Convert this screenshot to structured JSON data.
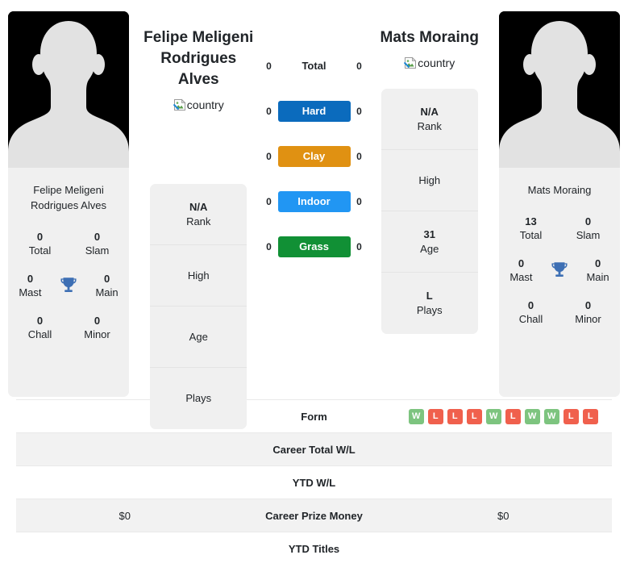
{
  "left_player": {
    "display_name": "Felipe Meligeni Rodrigues Alves",
    "name_line1": "Felipe Meligeni",
    "name_line2": "Rodrigues Alves",
    "country_alt": "country",
    "card_name_line1": "Felipe Meligeni",
    "card_name_line2": "Rodrigues Alves",
    "titles": [
      {
        "value": "0",
        "label": "Total"
      },
      {
        "value": "0",
        "label": "Slam"
      },
      {
        "value": "0",
        "label": "Mast"
      },
      {
        "value": "0",
        "label": "Main"
      },
      {
        "value": "0",
        "label": "Chall"
      },
      {
        "value": "0",
        "label": "Minor"
      }
    ],
    "info": [
      {
        "value": "N/A",
        "label": "Rank"
      },
      {
        "value": "",
        "label": "High"
      },
      {
        "value": "",
        "label": "Age"
      },
      {
        "value": "",
        "label": "Plays"
      }
    ]
  },
  "right_player": {
    "display_name": "Mats Moraing",
    "name_line1": "Mats Moraing",
    "country_alt": "country",
    "card_name_line1": "Mats Moraing",
    "titles": [
      {
        "value": "13",
        "label": "Total"
      },
      {
        "value": "0",
        "label": "Slam"
      },
      {
        "value": "0",
        "label": "Mast"
      },
      {
        "value": "0",
        "label": "Main"
      },
      {
        "value": "0",
        "label": "Chall"
      },
      {
        "value": "0",
        "label": "Minor"
      }
    ],
    "info": [
      {
        "value": "N/A",
        "label": "Rank"
      },
      {
        "value": "",
        "label": "High"
      },
      {
        "value": "31",
        "label": "Age"
      },
      {
        "value": "L",
        "label": "Plays"
      }
    ]
  },
  "surfaces": [
    {
      "label": "Total",
      "left": "0",
      "right": "0",
      "color": "transparent",
      "plain": true
    },
    {
      "label": "Hard",
      "left": "0",
      "right": "0",
      "color": "#0b6bbd",
      "plain": false
    },
    {
      "label": "Clay",
      "left": "0",
      "right": "0",
      "color": "#e09112",
      "plain": false
    },
    {
      "label": "Indoor",
      "left": "0",
      "right": "0",
      "color": "#2196f3",
      "plain": false
    },
    {
      "label": "Grass",
      "left": "0",
      "right": "0",
      "color": "#119035",
      "plain": false
    }
  ],
  "bottom_rows": [
    {
      "label": "Form",
      "left": "",
      "right": "",
      "striped": false,
      "type": "form"
    },
    {
      "label": "Career Total W/L",
      "left": "",
      "right": "",
      "striped": true,
      "type": "text"
    },
    {
      "label": "YTD W/L",
      "left": "",
      "right": "",
      "striped": false,
      "type": "text"
    },
    {
      "label": "Career Prize Money",
      "left": "$0",
      "right": "$0",
      "striped": true,
      "type": "text"
    },
    {
      "label": "YTD Titles",
      "left": "",
      "right": "",
      "striped": false,
      "type": "text"
    }
  ],
  "form_badges": [
    {
      "result": "W",
      "color": "#7dc47f"
    },
    {
      "result": "L",
      "color": "#f0604d"
    },
    {
      "result": "L",
      "color": "#f0604d"
    },
    {
      "result": "L",
      "color": "#f0604d"
    },
    {
      "result": "W",
      "color": "#7dc47f"
    },
    {
      "result": "L",
      "color": "#f0604d"
    },
    {
      "result": "W",
      "color": "#7dc47f"
    },
    {
      "result": "W",
      "color": "#7dc47f"
    },
    {
      "result": "L",
      "color": "#f0604d"
    },
    {
      "result": "L",
      "color": "#f0604d"
    }
  ],
  "colors": {
    "win": "#7dc47f",
    "loss": "#f0604d",
    "trophy": "#3d6fb4",
    "panel_bg": "#f0f0f0",
    "stripe_bg": "#f2f2f2"
  }
}
